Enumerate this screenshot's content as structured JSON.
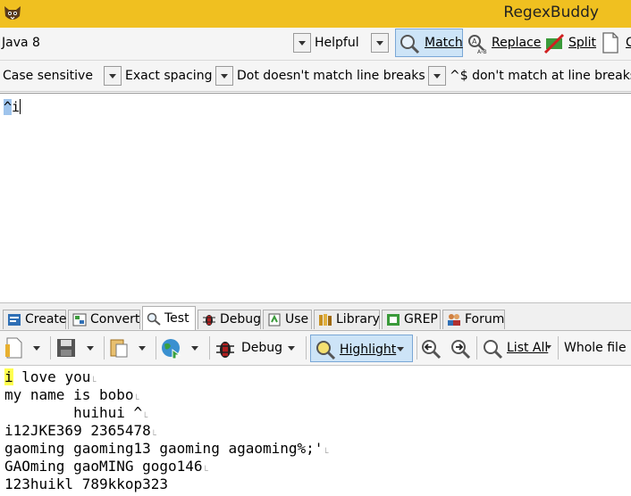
{
  "app": {
    "title": "RegexBuddy"
  },
  "toolbar": {
    "flavor": "Java 8",
    "helpful": "Helpful",
    "match": "Match",
    "replace": "Replace",
    "split": "Split",
    "overflow": "C"
  },
  "options": {
    "case": "Case sensitive",
    "spacing": "Exact spacing",
    "dot": "Dot doesn't match line breaks",
    "anchors": "^$ don't match at line breaks"
  },
  "regex": {
    "selected": "^",
    "rest": "i"
  },
  "tabs": [
    {
      "label": "Create"
    },
    {
      "label": "Convert"
    },
    {
      "label": "Test"
    },
    {
      "label": "Debug"
    },
    {
      "label": "Use"
    },
    {
      "label": "Library"
    },
    {
      "label": "GREP"
    },
    {
      "label": "Forum"
    }
  ],
  "test_toolbar": {
    "debug": "Debug",
    "highlight": "Highlight",
    "list_all": "List All",
    "scope": "Whole file"
  },
  "test_text": {
    "line1_match": "i",
    "line1_rest": " love you",
    "line2": "my name is bobo",
    "line3": "        huihui ^",
    "line4": "i12JKE369 2365478",
    "line5": "gaoming gaoming13 gaoming agaoming%;'",
    "line6": "GAOming gaoMING gogo146",
    "line7": "123huikl 789kkop323"
  },
  "colors": {
    "title_bar": "#f0c020",
    "active_button": "#cde4f7",
    "match_highlight": "#ffff50"
  }
}
